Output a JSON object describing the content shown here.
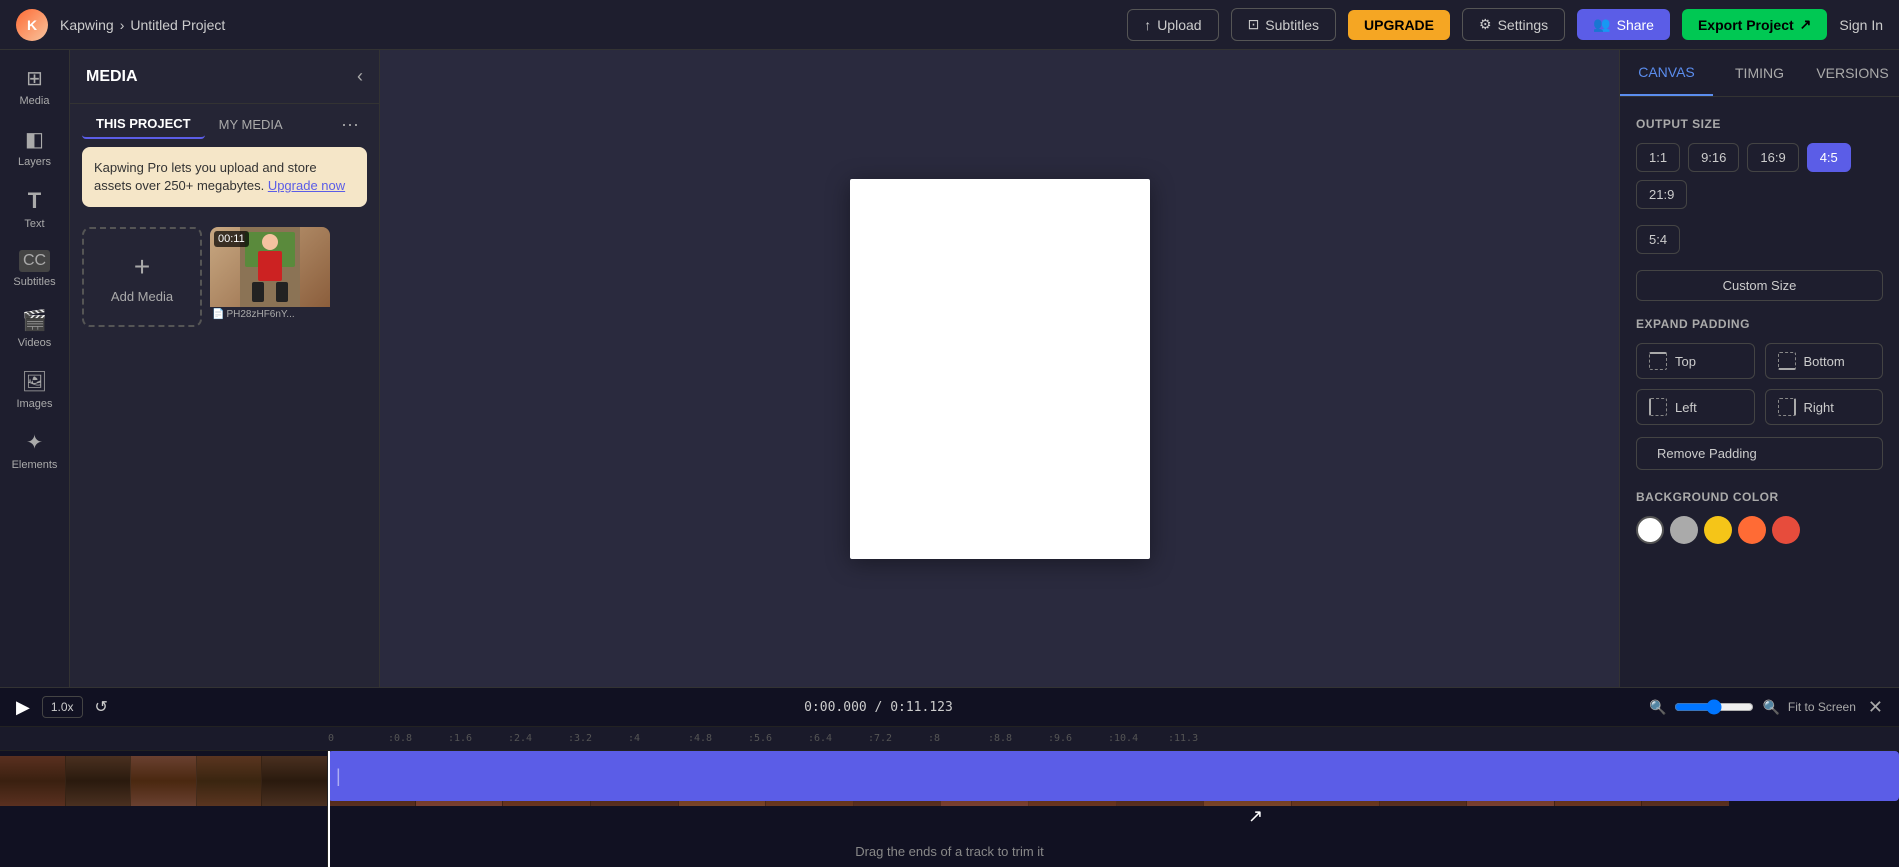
{
  "nav": {
    "logo_text": "K",
    "brand": "Kapwing",
    "breadcrumb_sep": "›",
    "project_name": "Untitled Project",
    "upload_label": "Upload",
    "subtitles_label": "Subtitles",
    "upgrade_label": "UPGRADE",
    "settings_label": "Settings",
    "share_label": "Share",
    "export_label": "Export Project",
    "signin_label": "Sign In"
  },
  "sidebar": {
    "items": [
      {
        "id": "media",
        "label": "Media",
        "icon": "⊞"
      },
      {
        "id": "layers",
        "label": "Layers",
        "icon": "◧"
      },
      {
        "id": "text",
        "label": "Text",
        "icon": "T"
      },
      {
        "id": "subtitles",
        "label": "Subtitles",
        "icon": "CC"
      },
      {
        "id": "videos",
        "label": "Videos",
        "icon": "▶"
      },
      {
        "id": "images",
        "label": "Images",
        "icon": "🔍"
      },
      {
        "id": "elements",
        "label": "Elements",
        "icon": "✦"
      }
    ]
  },
  "media_panel": {
    "title": "MEDIA",
    "tabs": [
      {
        "id": "this-project",
        "label": "THIS PROJECT",
        "active": true
      },
      {
        "id": "my-media",
        "label": "MY MEDIA",
        "active": false
      }
    ],
    "promo": {
      "text": "Kapwing Pro lets you upload and store assets over 250+ megabytes.",
      "link_text": "Upgrade now"
    },
    "add_media_label": "Add Media",
    "media_items": [
      {
        "duration": "00:11",
        "name": "PH28zHF6nY..."
      }
    ]
  },
  "canvas_tabs": [
    {
      "id": "canvas",
      "label": "CANVAS",
      "active": true
    },
    {
      "id": "timing",
      "label": "TIMING",
      "active": false
    },
    {
      "id": "versions",
      "label": "VERSIONS",
      "active": false
    }
  ],
  "canvas_panel": {
    "output_size_label": "OUTPUT SIZE",
    "size_options": [
      {
        "label": "1:1",
        "active": false
      },
      {
        "label": "9:16",
        "active": false
      },
      {
        "label": "16:9",
        "active": false
      },
      {
        "label": "4:5",
        "active": true
      },
      {
        "label": "21:9",
        "active": false
      }
    ],
    "size_options_row2": [
      {
        "label": "5:4",
        "active": false
      }
    ],
    "custom_size_label": "Custom Size",
    "expand_padding_label": "EXPAND PADDING",
    "padding_buttons": [
      {
        "id": "top",
        "label": "Top"
      },
      {
        "id": "bottom",
        "label": "Bottom"
      },
      {
        "id": "left",
        "label": "Left"
      },
      {
        "id": "right",
        "label": "Right"
      }
    ],
    "remove_padding_label": "Remove Padding",
    "background_color_label": "BACKGROUND COLOR",
    "colors": [
      {
        "hex": "#ffffff",
        "active": false
      },
      {
        "hex": "#cccccc",
        "active": false
      },
      {
        "hex": "#f5c518",
        "active": false
      },
      {
        "hex": "#ff6b35",
        "active": false
      },
      {
        "hex": "#e74c3c",
        "active": false
      }
    ]
  },
  "timeline": {
    "play_icon": "▶",
    "speed": "1.0x",
    "undo_icon": "↺",
    "time_display": "0:00.000 / 0:11.123",
    "fit_label": "Fit to Screen",
    "ruler_marks": [
      "0",
      ":0.8",
      ":1.6",
      ":2.4",
      ":3.2",
      ":4",
      ":4.8",
      ":5.6",
      ":6.4",
      ":7.2",
      ":8",
      ":8.8",
      ":9.6",
      ":10.4",
      ":11.3"
    ],
    "drag_hint": "Drag the ends of a track to trim it"
  }
}
